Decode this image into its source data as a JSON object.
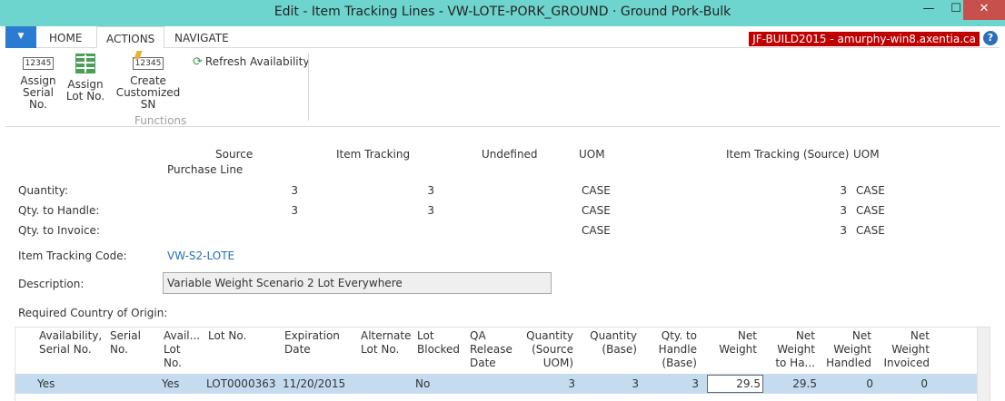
{
  "window": {
    "title": "Edit - Item Tracking Lines - VW-LOTE-PORK_GROUND · Ground Pork-Bulk",
    "minimize": "—",
    "maximize": "☐",
    "close": "✕"
  },
  "ribbon": {
    "tabs": [
      "HOME",
      "ACTIONS",
      "NAVIGATE"
    ],
    "active_tab": "ACTIONS",
    "server_badge": "JF-BUILD2015 - amurphy-win8.axentia.ca",
    "help": "?",
    "buttons": {
      "assign_serial": {
        "line1": "Assign",
        "line2": "Serial No.",
        "icon": "12345"
      },
      "assign_lot": {
        "line1": "Assign",
        "line2": "Lot No."
      },
      "create_custom": {
        "line1": "Create",
        "line2": "Customized SN",
        "icon": "12345"
      },
      "refresh": "Refresh Availability"
    },
    "group_label": "Functions"
  },
  "summary": {
    "headers": {
      "source": "Source",
      "source_sub": "Purchase Line",
      "item_tracking": "Item Tracking",
      "undefined": "Undefined",
      "uom": "UOM",
      "item_tracking_source": "Item Tracking (Source)",
      "uom2": "UOM"
    },
    "rows": [
      {
        "label": "Quantity:",
        "source": "3",
        "item_tracking": "3",
        "uom": "CASE",
        "its": "3",
        "uom2": "CASE"
      },
      {
        "label": "Qty. to Handle:",
        "source": "3",
        "item_tracking": "3",
        "uom": "CASE",
        "its": "3",
        "uom2": "CASE"
      },
      {
        "label": "Qty. to Invoice:",
        "source": "",
        "item_tracking": "",
        "uom": "CASE",
        "its": "3",
        "uom2": "CASE"
      }
    ],
    "item_tracking_code_label": "Item Tracking Code:",
    "item_tracking_code": "VW-S2-LOTE",
    "description_label": "Description:",
    "description": "Variable Weight Scenario 2 Lot Everywhere",
    "country_label": "Required Country of Origin:"
  },
  "grid": {
    "headers": {
      "availability_serial": [
        "Availability,",
        "Serial No."
      ],
      "serial_no": [
        "Serial",
        "No."
      ],
      "avail_lot": [
        "Avail...",
        "Lot",
        "No."
      ],
      "lot_no": [
        "Lot No."
      ],
      "expiration": [
        "Expiration",
        "Date"
      ],
      "alt_lot": [
        "Alternate",
        "Lot No."
      ],
      "lot_blocked": [
        "Lot",
        "Blocked"
      ],
      "qa_release": [
        "QA",
        "Release",
        "Date"
      ],
      "qty_source": [
        "Quantity",
        "(Source",
        "UOM)"
      ],
      "qty_base": [
        "Quantity",
        "(Base)"
      ],
      "qty_handle": [
        "Qty. to",
        "Handle",
        "(Base)"
      ],
      "net_weight": [
        "Net",
        "Weight"
      ],
      "net_weight_handle": [
        "Net",
        "Weight",
        "to Ha..."
      ],
      "net_weight_handled": [
        "Net",
        "Weight",
        "Handled"
      ],
      "net_weight_invoiced": [
        "Net",
        "Weight",
        "Invoiced"
      ]
    },
    "row": {
      "availability_serial": "Yes",
      "avail_lot": "Yes",
      "lot_no": "LOT0000363",
      "expiration": "11/20/2015",
      "lot_blocked": "No",
      "qty_source": "3",
      "qty_base": "3",
      "qty_handle": "3",
      "net_weight": "29.5",
      "net_weight_handle": "29.5",
      "net_weight_handled": "0",
      "net_weight_invoiced": "0"
    }
  }
}
